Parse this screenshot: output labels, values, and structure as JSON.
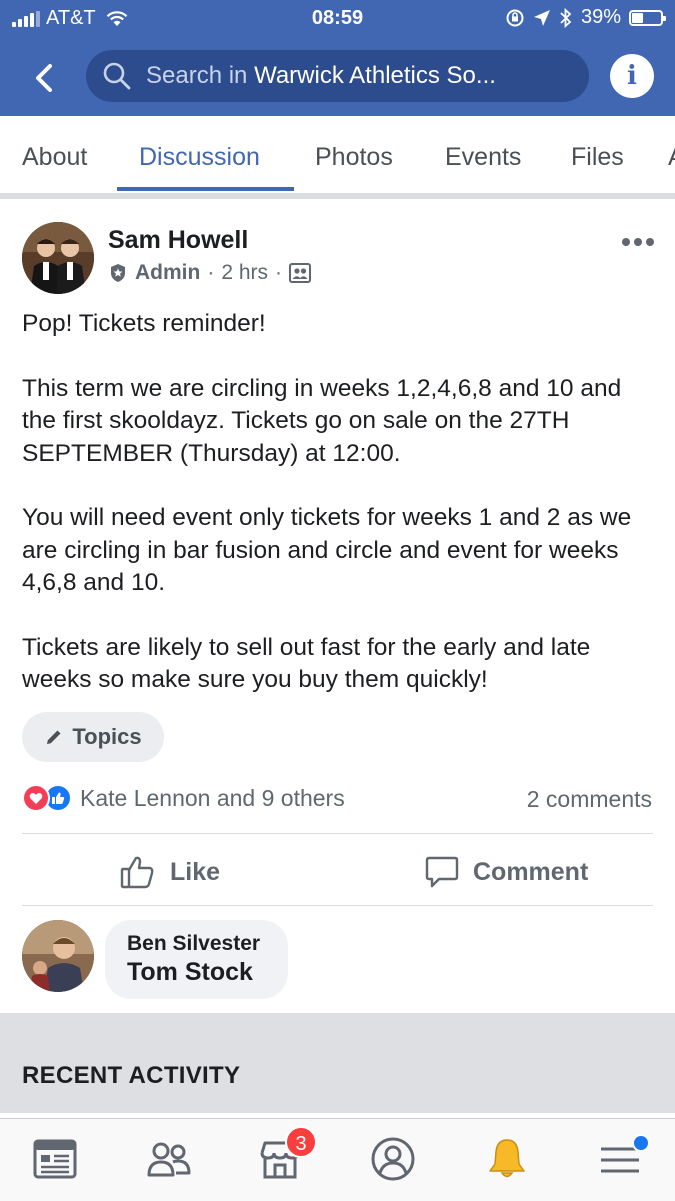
{
  "status_bar": {
    "carrier": "AT&T",
    "time": "08:59",
    "battery_text": "39%",
    "battery_level": 0.39
  },
  "search": {
    "prefix": "Search in ",
    "group_name": "Warwick Athletics So..."
  },
  "tabs": [
    "About",
    "Discussion",
    "Photos",
    "Events",
    "Files"
  ],
  "active_tab": "Discussion",
  "post": {
    "author": "Sam Howell",
    "role": "Admin",
    "time": "2 hrs",
    "paragraphs": [
      "Pop! Tickets reminder!",
      "This term we are circling in weeks 1,2,4,6,8 and 10 and the first skooldayz. Tickets go on sale on the 27TH SEPTEMBER (Thursday) at 12:00.",
      "You will need event only tickets for weeks 1 and 2 as we are circling in bar fusion and circle and event for weeks 4,6,8 and 10.",
      "Tickets are likely to sell out fast for the early and late weeks so make sure you buy them quickly!"
    ],
    "topics_label": "Topics",
    "reactions_text": "Kate Lennon and 9 others",
    "comments_count": "2 comments",
    "like_label": "Like",
    "comment_label": "Comment"
  },
  "comment": {
    "author": "Ben Silvester",
    "text": "Tom Stock"
  },
  "recent_activity_label": "RECENT ACTIVITY",
  "bottom_nav": {
    "items": [
      "news-feed-icon",
      "groups-icon",
      "marketplace-icon",
      "profile-icon",
      "notifications-icon",
      "menu-icon"
    ],
    "marketplace_badge": "3"
  },
  "colors": {
    "brand": "#4267b2",
    "love": "#f33e58",
    "like": "#1877f2",
    "badge": "#fa3e3e",
    "notifications": "#f7b928"
  }
}
